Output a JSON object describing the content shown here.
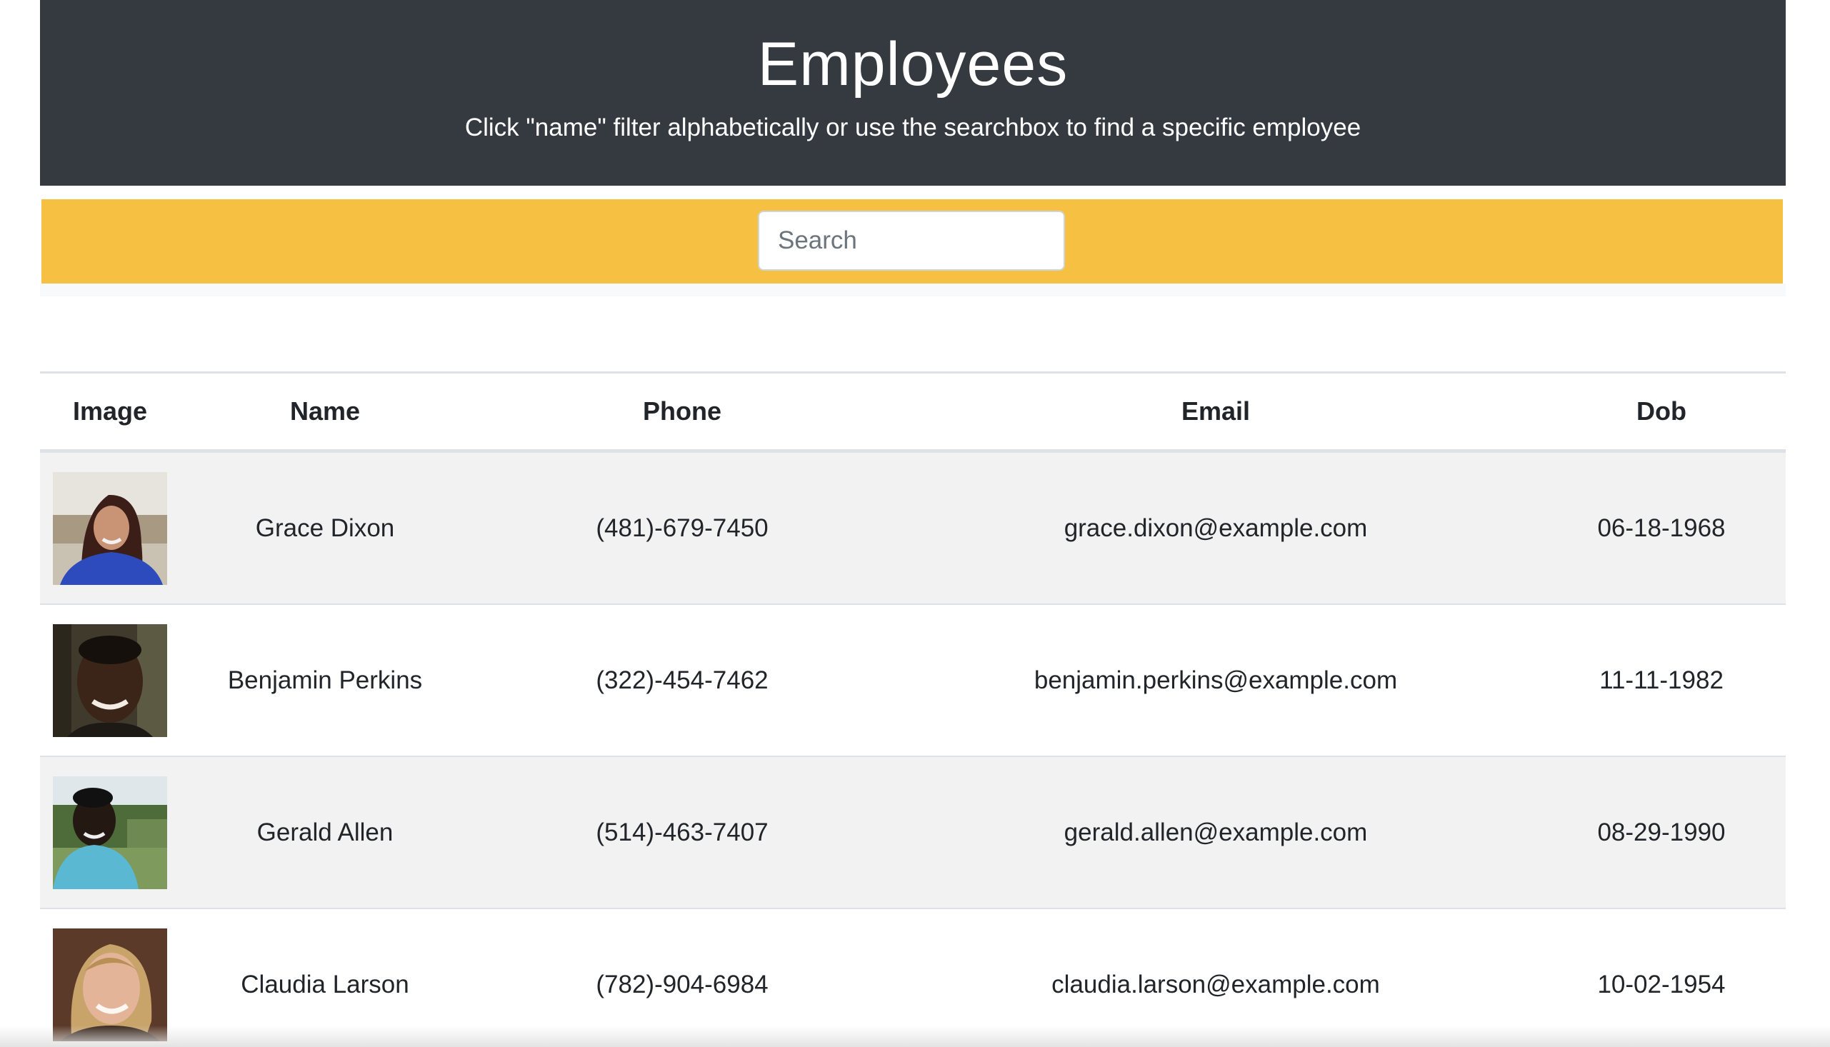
{
  "header": {
    "title": "Employees",
    "subtitle": "Click \"name\" filter alphabetically or use the searchbox to find a specific employee",
    "background_color": "#343a40"
  },
  "search": {
    "placeholder": "Search",
    "value": "",
    "band_color": "#f6c143"
  },
  "table": {
    "columns": [
      "Image",
      "Name",
      "Phone",
      "Email",
      "Dob"
    ],
    "rows": [
      {
        "image": "employee-photo-woman-dark-hair-blue-top",
        "name": "Grace Dixon",
        "phone": "(481)-679-7450",
        "email": "grace.dixon@example.com",
        "dob": "06-18-1968"
      },
      {
        "image": "employee-photo-man-smiling-dark-background",
        "name": "Benjamin Perkins",
        "phone": "(322)-454-7462",
        "email": "benjamin.perkins@example.com",
        "dob": "11-11-1982"
      },
      {
        "image": "employee-photo-man-outdoor-cyan-shirt",
        "name": "Gerald Allen",
        "phone": "(514)-463-7407",
        "email": "gerald.allen@example.com",
        "dob": "08-29-1990"
      },
      {
        "image": "employee-photo-woman-blonde-smiling",
        "name": "Claudia Larson",
        "phone": "(782)-904-6984",
        "email": "claudia.larson@example.com",
        "dob": "10-02-1954"
      }
    ],
    "striped_row_color": "#f2f2f2"
  }
}
